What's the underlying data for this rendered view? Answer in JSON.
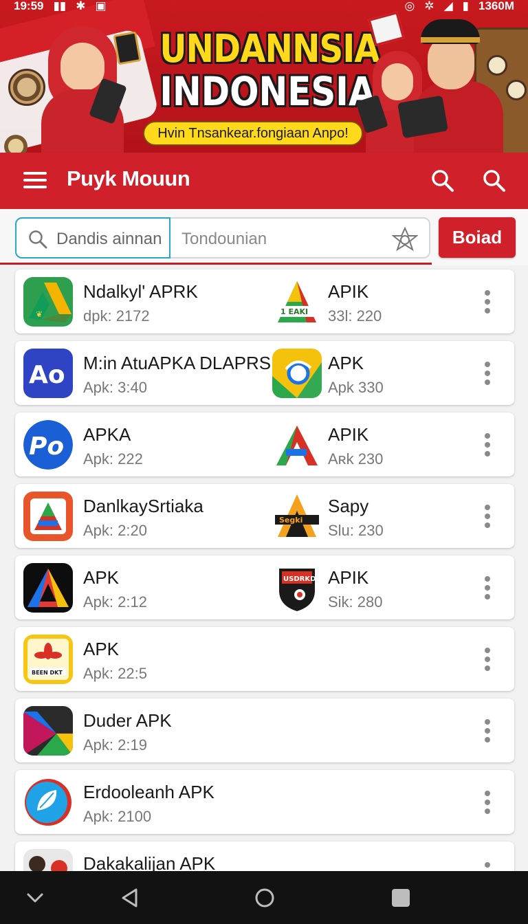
{
  "status_bar": {
    "time": "19:59",
    "right_text": "1360M"
  },
  "banner": {
    "title_line1": "UNDANNSIA",
    "title_line2": "INDONESIA",
    "slogan": "Hvin Tnsankear.fongiaan Anƿo!"
  },
  "app_bar": {
    "title": "Puyk Mouun",
    "icons": [
      "menu-icon",
      "search-icon",
      "search-icon"
    ]
  },
  "search": {
    "left_text": "Dandis ainnan",
    "right_text": "Tondounian",
    "action_label": "Boiad"
  },
  "list": [
    {
      "left_name": "Ndalkyl' APRK",
      "left_meta": "dpk: 2172",
      "right_name": "APIK",
      "right_meta": "33l: 220"
    },
    {
      "left_name": "M:in AtuAPKA DLAPRS",
      "left_meta": "Apk: 3:40",
      "right_name": "APK",
      "right_meta": "Apk 330"
    },
    {
      "left_name": "APKA",
      "left_meta": "Apk: 222",
      "right_name": "APIK",
      "right_meta": "Aʀk 230"
    },
    {
      "left_name": "DanlkaySrtiaka",
      "left_meta": "Apk: 2:20",
      "right_name": "Sapy",
      "right_meta": "Slu: 230"
    },
    {
      "left_name": "APK",
      "left_meta": "Apk: 2:12",
      "right_name": "APIK",
      "right_meta": "Sik: 280"
    },
    {
      "left_name": "APK",
      "left_meta": "Apk: 22:5",
      "right_name": "",
      "right_meta": ""
    },
    {
      "left_name": "Duder APK",
      "left_meta": "Apk: 2:19",
      "right_name": "",
      "right_meta": ""
    },
    {
      "left_name": "Erdooleanh APK",
      "left_meta": "Apk: 2100",
      "right_name": "",
      "right_meta": ""
    },
    {
      "left_name": "Dakakalijan APK",
      "left_meta": "",
      "right_name": "",
      "right_meta": ""
    }
  ],
  "icon_text": {
    "row2_left": "Ao",
    "row3_left": "Po",
    "row1_right_badge": "1 EAKI",
    "row4_right_badge": "Segki",
    "row5_right_badge": "USDRKD",
    "row6_left_badge": "BEEN DKT"
  },
  "colors": {
    "brand_red": "#d0202a",
    "search_focus": "#2aa6c6",
    "navbar": "#121212"
  },
  "nav_bar": {
    "icons": [
      "chevron-down-icon",
      "back-icon",
      "home-icon",
      "recents-icon"
    ]
  }
}
